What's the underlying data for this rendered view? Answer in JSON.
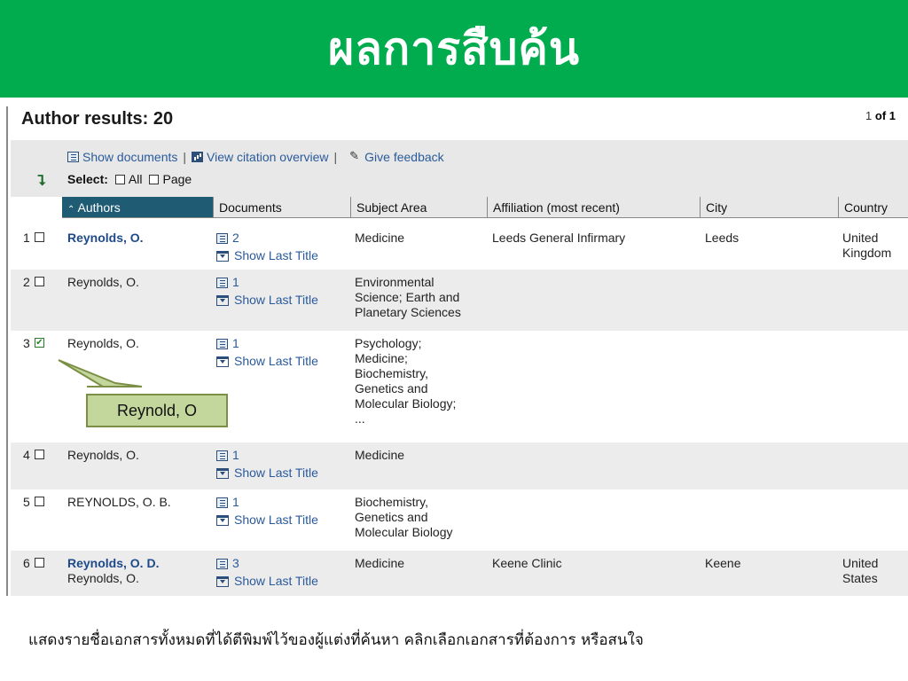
{
  "banner": {
    "title": "ผลการสืบค้น",
    "color": "#00ac4e"
  },
  "results": {
    "title": "Author results: 20",
    "pager_current": "1",
    "pager_total": "of 1"
  },
  "toolbar": {
    "show_documents": "Show documents",
    "view_citation": "View citation overview",
    "give_feedback": "Give feedback",
    "separator": "|",
    "select_label": "Select:",
    "select_all": "All",
    "select_page": "Page"
  },
  "columns": {
    "authors": "Authors",
    "documents": "Documents",
    "subject_area": "Subject Area",
    "affiliation": "Affiliation (most recent)",
    "city": "City",
    "country": "Country"
  },
  "show_last_title": "Show Last Title",
  "rows": [
    {
      "num": "1",
      "author": "Reynolds, O.",
      "author_link": true,
      "alt_name": "",
      "docs": "2",
      "subject": [
        "Medicine"
      ],
      "affiliation": "Leeds General Infirmary",
      "city": "Leeds",
      "country": [
        "United",
        "Kingdom"
      ],
      "checked": false
    },
    {
      "num": "2",
      "author": "Reynolds, O.",
      "author_link": false,
      "alt_name": "",
      "docs": "1",
      "subject": [
        "Environmental",
        "Science; Earth and",
        "Planetary Sciences"
      ],
      "affiliation": "",
      "city": "",
      "country": [],
      "checked": false
    },
    {
      "num": "3",
      "author": "Reynolds, O.",
      "author_link": false,
      "alt_name": "",
      "docs": "1",
      "subject": [
        "Psychology;",
        "Medicine;",
        "Biochemistry,",
        "Genetics and",
        "Molecular Biology;",
        "..."
      ],
      "affiliation": "",
      "city": "",
      "country": [],
      "checked": true
    },
    {
      "num": "4",
      "author": "Reynolds, O.",
      "author_link": false,
      "alt_name": "",
      "docs": "1",
      "subject": [
        "Medicine"
      ],
      "affiliation": "",
      "city": "",
      "country": [],
      "checked": false
    },
    {
      "num": "5",
      "author": "REYNOLDS, O. B.",
      "author_link": false,
      "alt_name": "",
      "docs": "1",
      "subject": [
        "Biochemistry,",
        "Genetics and",
        "Molecular Biology"
      ],
      "affiliation": "",
      "city": "",
      "country": [],
      "checked": false
    },
    {
      "num": "6",
      "author": "Reynolds, O. D.",
      "author_link": true,
      "alt_name": "Reynolds, O.",
      "docs": "3",
      "subject": [
        "Medicine"
      ],
      "affiliation": "Keene Clinic",
      "city": "Keene",
      "country": [
        "United",
        "States"
      ],
      "checked": false
    }
  ],
  "callout": {
    "text": "Reynold, O"
  },
  "caption": "แสดงรายชื่อเอกสารทั้งหมดที่ได้ตีพิมพ์ไว้ของผู้แต่งที่ค้นหา คลิกเลือกเอกสารที่ต้องการ หรือสนใจ"
}
